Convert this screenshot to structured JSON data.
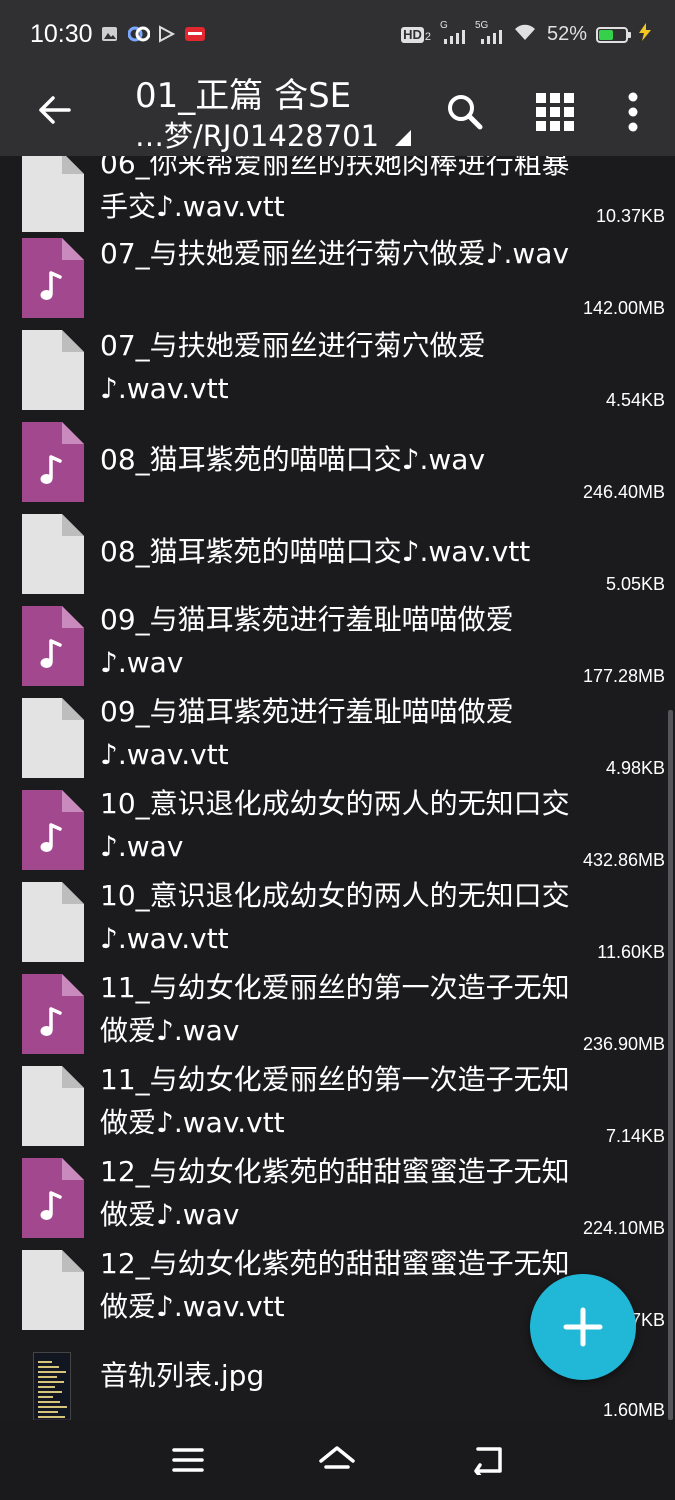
{
  "status_bar": {
    "time": "10:30",
    "battery": "52%",
    "battery_level": 0.52,
    "hd_label": "HD",
    "hd_sub": "2",
    "net_g": "G",
    "net_5g": "5G"
  },
  "app_bar": {
    "title": "01_正篇 含SE",
    "path": "…梦/RJ01428701"
  },
  "files": [
    {
      "name": "06_你来帮爱丽丝的扶她肉棒进行粗暴手交♪.wav.vtt",
      "size": "10.37KB",
      "type": "document"
    },
    {
      "name": "07_与扶她爱丽丝进行菊穴做爱♪.wav",
      "size": "142.00MB",
      "type": "audio"
    },
    {
      "name": "07_与扶她爱丽丝进行菊穴做爱♪.wav.vtt",
      "size": "4.54KB",
      "type": "document"
    },
    {
      "name": "08_猫耳紫苑的喵喵口交♪.wav",
      "size": "246.40MB",
      "type": "audio"
    },
    {
      "name": "08_猫耳紫苑的喵喵口交♪.wav.vtt",
      "size": "5.05KB",
      "type": "document"
    },
    {
      "name": "09_与猫耳紫苑进行羞耻喵喵做爱♪.wav",
      "size": "177.28MB",
      "type": "audio"
    },
    {
      "name": "09_与猫耳紫苑进行羞耻喵喵做爱♪.wav.vtt",
      "size": "4.98KB",
      "type": "document"
    },
    {
      "name": "10_意识退化成幼女的两人的无知口交♪.wav",
      "size": "432.86MB",
      "type": "audio"
    },
    {
      "name": "10_意识退化成幼女的两人的无知口交♪.wav.vtt",
      "size": "11.60KB",
      "type": "document"
    },
    {
      "name": "11_与幼女化爱丽丝的第一次造子无知做爱♪.wav",
      "size": "236.90MB",
      "type": "audio"
    },
    {
      "name": "11_与幼女化爱丽丝的第一次造子无知做爱♪.wav.vtt",
      "size": "7.14KB",
      "type": "document"
    },
    {
      "name": "12_与幼女化紫苑的甜甜蜜蜜造子无知做爱♪.wav",
      "size": "224.10MB",
      "type": "audio"
    },
    {
      "name": "12_与幼女化紫苑的甜甜蜜蜜造子无知做爱♪.wav.vtt",
      "size": "7KB",
      "type": "document"
    },
    {
      "name": "音轨列表.jpg",
      "size": "1.60MB",
      "type": "image"
    }
  ],
  "icons": {
    "back": "arrow-left-icon",
    "search": "search-icon",
    "grid": "grid-view-icon",
    "more": "more-vert-icon",
    "fab": "plus-icon",
    "nav_menu": "menu-icon",
    "nav_home": "home-icon",
    "nav_back": "back-icon"
  },
  "colors": {
    "background": "#1b1b1d",
    "app_bar": "#303033",
    "audio_icon": "#a2488f",
    "document_icon": "#e3e3e3",
    "fab": "#21b8d7",
    "battery": "#35d14b"
  }
}
